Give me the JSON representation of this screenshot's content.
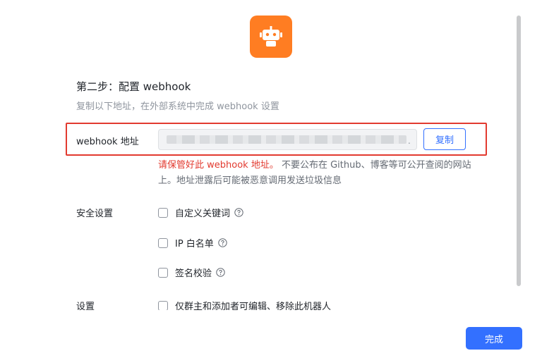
{
  "step": {
    "title": "第二步：配置 webhook",
    "subtitle": "复制以下地址，在外部系统中完成 webhook 设置"
  },
  "webhook": {
    "label": "webhook 地址",
    "masked_suffix": ".",
    "copy_label": "复制",
    "warning_red": "请保管好此 webhook 地址。",
    "warning_rest": " 不要公布在 Github、博客等可公开查阅的网站上。地址泄露后可能被恶意调用发送垃圾信息"
  },
  "security": {
    "label": "安全设置",
    "options": [
      {
        "label": "自定义关键词",
        "checked": false
      },
      {
        "label": "IP 白名单",
        "checked": false
      },
      {
        "label": "签名校验",
        "checked": false
      }
    ]
  },
  "settings": {
    "label": "设置",
    "option": {
      "label": "仅群主和添加者可编辑、移除此机器人",
      "checked": false
    }
  },
  "footer": {
    "done_label": "完成"
  },
  "colors": {
    "accent": "#3370ff",
    "warning": "#e23a2f",
    "bot_bg": "#ff7d22"
  },
  "icons": {
    "bot": "robot-icon",
    "help": "question-circle-icon"
  }
}
